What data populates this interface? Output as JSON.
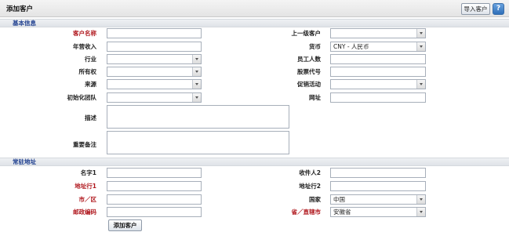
{
  "header": {
    "title": "添加客户",
    "import_label": "导入客户",
    "help_label": "?"
  },
  "sections": {
    "basic": "基本信息",
    "address": "常驻地址"
  },
  "basic": {
    "customer_name": "客户名称",
    "annual_revenue": "年营收入",
    "industry": "行业",
    "ownership": "所有权",
    "source": "来源",
    "initial_team": "初始化团队",
    "parent_account": "上一级客户",
    "currency": "货币",
    "currency_value": "CNY - 人民币",
    "employees": "员工人数",
    "ticker": "股票代号",
    "campaign": "促销活动",
    "website": "网址",
    "description": "描述",
    "important_notes": "重要备注"
  },
  "address": {
    "name1": "名字1",
    "line1": "地址行1",
    "city": "市／区",
    "postcode": "邮政编码",
    "recipient2": "收件人2",
    "line2": "地址行2",
    "country": "国家",
    "country_value": "中国",
    "province": "省／直辖市",
    "province_value": "安徽省"
  },
  "footer": {
    "submit_label": "添加客户"
  },
  "colors": {
    "required": "#b0181e",
    "section_text": "#1f3f8f"
  }
}
